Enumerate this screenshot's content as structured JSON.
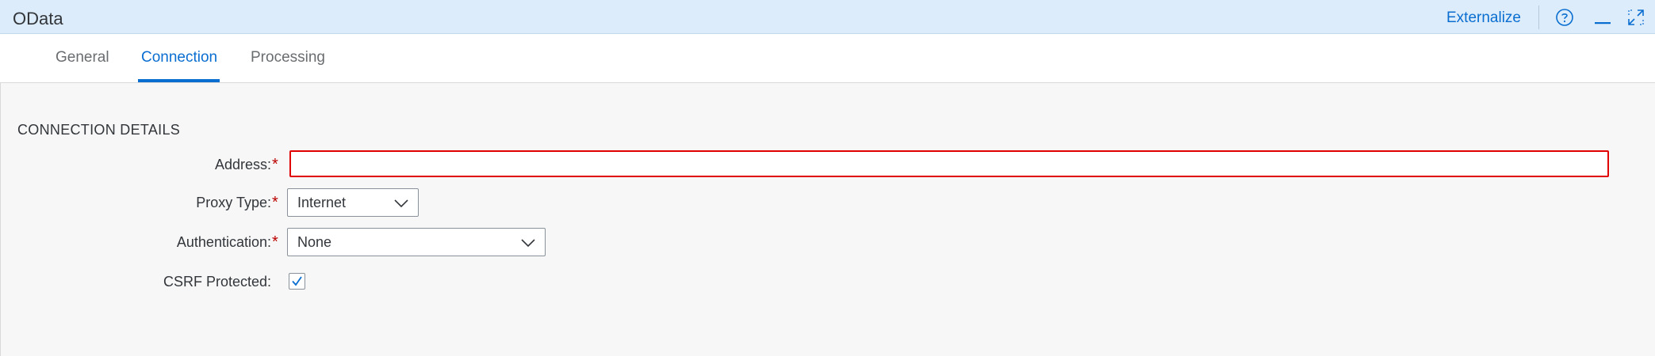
{
  "window": {
    "title": "OData",
    "externalize_label": "Externalize",
    "icons": [
      "help-icon",
      "minimize-icon",
      "maximize-icon"
    ]
  },
  "tabs": [
    {
      "label": "General",
      "active": false
    },
    {
      "label": "Connection",
      "active": true
    },
    {
      "label": "Processing",
      "active": false
    }
  ],
  "section": {
    "title": "CONNECTION DETAILS"
  },
  "form": {
    "address": {
      "label": "Address:",
      "required_mark": "*",
      "value": "",
      "error": true
    },
    "proxy_type": {
      "label": "Proxy Type:",
      "required_mark": "*",
      "value": "Internet"
    },
    "authentication": {
      "label": "Authentication:",
      "required_mark": "*",
      "value": "None"
    },
    "csrf_protected": {
      "label": "CSRF Protected:",
      "checked": true
    }
  },
  "colors": {
    "accent": "#0a6ed1",
    "header_bg": "#dcecfa",
    "error": "#e00000",
    "required": "#bb0000"
  }
}
